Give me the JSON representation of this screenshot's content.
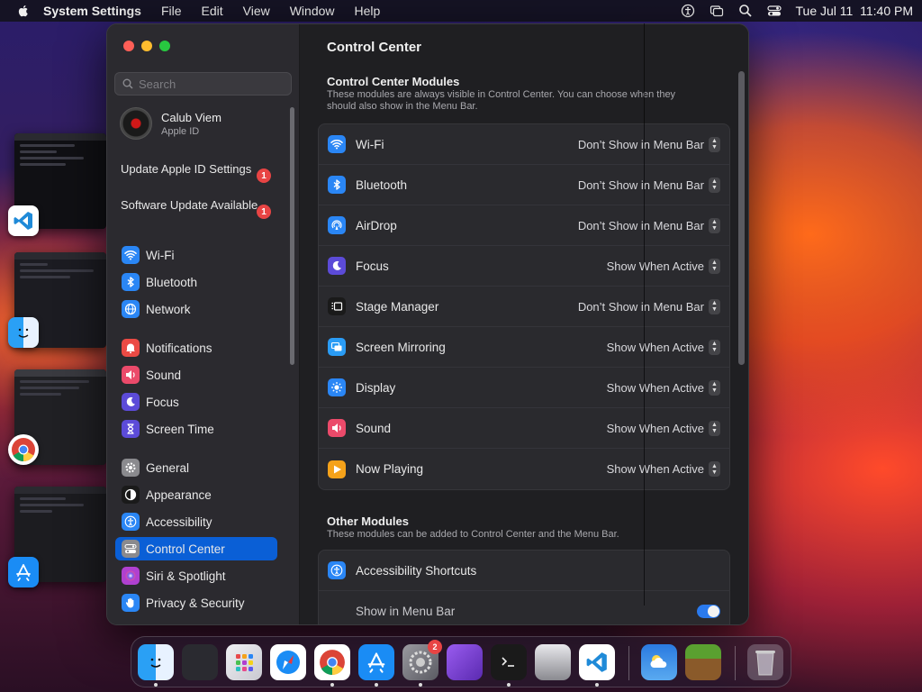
{
  "menubar": {
    "app_name": "System Settings",
    "menus": [
      "File",
      "Edit",
      "View",
      "Window",
      "Help"
    ],
    "datetime": "Tue Jul 11  11:40 PM"
  },
  "window": {
    "title": "Control Center"
  },
  "sidebar": {
    "search_placeholder": "Search",
    "account": {
      "name": "Calub Viem",
      "subtitle": "Apple ID"
    },
    "notices": [
      {
        "label": "Update Apple ID Settings",
        "badge": "1"
      },
      {
        "label": "Software Update Available",
        "badge": "1"
      }
    ],
    "items": [
      {
        "label": "Wi-Fi",
        "icon": "wifi-icon",
        "color": "#2a86f5"
      },
      {
        "label": "Bluetooth",
        "icon": "bluetooth-icon",
        "color": "#2a86f5"
      },
      {
        "label": "Network",
        "icon": "globe-icon",
        "color": "#2a86f5"
      },
      {
        "label": "Notifications",
        "icon": "bell-icon",
        "color": "#eb4a44"
      },
      {
        "label": "Sound",
        "icon": "speaker-icon",
        "color": "#eb4a6a"
      },
      {
        "label": "Focus",
        "icon": "moon-icon",
        "color": "#5c4bd8"
      },
      {
        "label": "Screen Time",
        "icon": "hourglass-icon",
        "color": "#5c4bd8"
      },
      {
        "label": "General",
        "icon": "gear-icon",
        "color": "#8a8a8e"
      },
      {
        "label": "Appearance",
        "icon": "appearance-icon",
        "color": "#1a1a1a"
      },
      {
        "label": "Accessibility",
        "icon": "accessibility-icon",
        "color": "#2a86f5"
      },
      {
        "label": "Control Center",
        "icon": "control-center-icon",
        "color": "#8a8a8e",
        "active": true
      },
      {
        "label": "Siri & Spotlight",
        "icon": "siri-icon",
        "color": "#b040d0"
      },
      {
        "label": "Privacy & Security",
        "icon": "hand-icon",
        "color": "#2a86f5"
      }
    ]
  },
  "main": {
    "modules_title": "Control Center Modules",
    "modules_desc": "These modules are always visible in Control Center. You can choose when they should also show in the Menu Bar.",
    "modules": [
      {
        "label": "Wi-Fi",
        "value": "Don’t Show in Menu Bar",
        "icon": "wifi-icon",
        "color": "#2a86f5"
      },
      {
        "label": "Bluetooth",
        "value": "Don’t Show in Menu Bar",
        "icon": "bluetooth-icon",
        "color": "#2a86f5"
      },
      {
        "label": "AirDrop",
        "value": "Don’t Show in Menu Bar",
        "icon": "airdrop-icon",
        "color": "#2a86f5"
      },
      {
        "label": "Focus",
        "value": "Show When Active",
        "icon": "moon-icon",
        "color": "#5c4bd8"
      },
      {
        "label": "Stage Manager",
        "value": "Don’t Show in Menu Bar",
        "icon": "stage-manager-icon",
        "color": "#1a1a1a"
      },
      {
        "label": "Screen Mirroring",
        "value": "Show When Active",
        "icon": "screen-mirroring-icon",
        "color": "#2a9cf5"
      },
      {
        "label": "Display",
        "value": "Show When Active",
        "icon": "sun-icon",
        "color": "#2a86f5"
      },
      {
        "label": "Sound",
        "value": "Show When Active",
        "icon": "speaker-icon",
        "color": "#eb4a6a"
      },
      {
        "label": "Now Playing",
        "value": "Show When Active",
        "icon": "play-icon",
        "color": "#f5a21a"
      }
    ],
    "other_title": "Other Modules",
    "other_desc": "These modules can be added to Control Center and the Menu Bar.",
    "other_modules": [
      {
        "label": "Accessibility Shortcuts",
        "icon": "accessibility-icon",
        "color": "#2a86f5"
      }
    ],
    "show_in_menu_bar_label": "Show in Menu Bar",
    "show_in_menu_bar_on": true
  },
  "dock": {
    "apps": [
      "Finder",
      "Mission Control",
      "Launchpad",
      "Safari",
      "Chrome",
      "App Store",
      "System Settings",
      "Simulator",
      "Terminal",
      "Installer",
      "Visual Studio Code",
      "Weather",
      "Minecraft",
      "Trash"
    ],
    "system_settings_badge": "2"
  }
}
